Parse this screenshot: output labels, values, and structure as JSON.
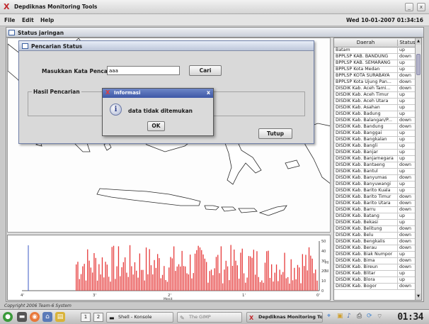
{
  "window": {
    "title": "Depdiknas Monitoring Tools",
    "minimize_glyph": "_",
    "close_glyph": "x"
  },
  "menu": {
    "items": [
      "File",
      "Edit",
      "Help"
    ],
    "datetime": "Wed 10-01-2007 01:34:16"
  },
  "frame": {
    "title": "Status jaringan"
  },
  "search_dialog": {
    "title": "Pencarian Status",
    "search_label": "Masukkan Kata Pencarian",
    "search_value": "aaa",
    "search_button": "Cari",
    "results_label": "Hasil Pencarian",
    "close_button": "Tutup"
  },
  "message_box": {
    "title": "Informasi",
    "icon_glyph": "i",
    "message": "data tidak ditemukan",
    "ok_button": "OK",
    "close_glyph": "x"
  },
  "status_table": {
    "columns": [
      "Daerah",
      "Status"
    ],
    "rows": [
      [
        "Batam",
        "up"
      ],
      [
        "BPPLSP KAB. BANDUNG",
        "down"
      ],
      [
        "BPPLSP KAB. SEMARANG",
        "up"
      ],
      [
        "BPPLSP Kota Medan",
        "up"
      ],
      [
        "BPPLSP KOTA SURABAYA",
        "down"
      ],
      [
        "BPPLSP Kota Ujung Pan...",
        "down"
      ],
      [
        "DISDIK Kab. Aceh Tami...",
        "down"
      ],
      [
        "DISDIK Kab. Aceh Timur",
        "up"
      ],
      [
        "DISDIK Kab. Aceh Utara",
        "up"
      ],
      [
        "DISDIK Kab. Asahan",
        "up"
      ],
      [
        "DISDIK Kab. Badung",
        "up"
      ],
      [
        "DISDIK Kab. Balangan/P...",
        "down"
      ],
      [
        "DISDIK Kab. Bandung",
        "down"
      ],
      [
        "DISDIK Kab. Banggai",
        "up"
      ],
      [
        "DISDIK Kab. Bangkalan",
        "up"
      ],
      [
        "DISDIK Kab. Bangli",
        "up"
      ],
      [
        "DISDIK Kab. Banjar",
        "up"
      ],
      [
        "DISDIK Kab. Banjarnegara",
        "up"
      ],
      [
        "DISDIK Kab. Bantaeng",
        "down"
      ],
      [
        "DISDIK Kab. Bantul",
        "up"
      ],
      [
        "DISDIK Kab. Banyumas",
        "down"
      ],
      [
        "DISDIK Kab. Banyuwangi",
        "up"
      ],
      [
        "DISDIK Kab. Barito Kuala",
        "up"
      ],
      [
        "DISDIK Kab. Barito Timur",
        "down"
      ],
      [
        "DISDIK Kab. Barito Utara",
        "down"
      ],
      [
        "DISDIK Kab. Barru",
        "down"
      ],
      [
        "DISDIK Kab. Batang",
        "up"
      ],
      [
        "DISDIK Kab. Bekasi",
        "up"
      ],
      [
        "DISDIK Kab. Belitung",
        "down"
      ],
      [
        "DISDIK Kab. Belu",
        "down"
      ],
      [
        "DISDIK Kab. Bengkalis",
        "down"
      ],
      [
        "DISDIK Kab. Berau",
        "down"
      ],
      [
        "DISDIK Kab. Biak Numpor",
        "up"
      ],
      [
        "DISDIK Kab. Bima",
        "down"
      ],
      [
        "DISDIK Kab. Bireun",
        "down"
      ],
      [
        "DISDIK Kab. Blitar",
        "up"
      ],
      [
        "DISDIK Kab. Blora",
        "up"
      ],
      [
        "DISDIK Kab. Bogor",
        "down"
      ]
    ]
  },
  "graph": {
    "y_ticks": [
      "50",
      "40",
      "30",
      "20",
      "10",
      "0"
    ],
    "x_ticks": [
      "4'",
      "3'",
      "2'",
      "1'",
      "0'"
    ],
    "x_label": "Menit",
    "side_labels": [
      "Hl",
      "Nl"
    ],
    "bar_color": "#e63a3a",
    "line_color": "#3b58c6"
  },
  "copyright": "Copyright 2006 Team-6 System",
  "taskbar": {
    "desktops": [
      "1",
      "2"
    ],
    "tasks": [
      {
        "label": "Shell - Konsole"
      },
      {
        "label": "The GIMP"
      },
      {
        "label": "Depdiknas Monitoring Tools"
      }
    ],
    "clock": "01:34"
  }
}
